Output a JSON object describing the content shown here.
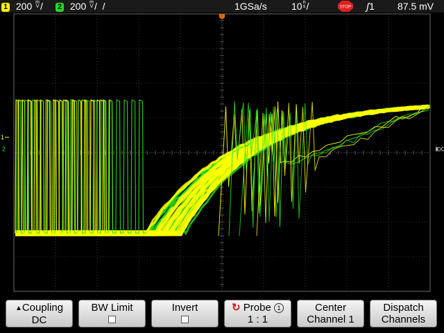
{
  "status": {
    "ch1": {
      "number": "1",
      "scale": "200",
      "unit_top": "m",
      "unit_bottom": "V",
      "color": "#ffff00"
    },
    "ch2": {
      "number": "2",
      "scale": "200",
      "unit_top": "m",
      "unit_bottom": "V",
      "color": "#22dd22"
    },
    "sample_rate": "1GSa/s",
    "timebase": {
      "value": "10",
      "unit_top": "n",
      "unit_bottom": "s"
    },
    "run_state": "STOP",
    "trigger_source": "1",
    "trigger_level": "87.5 mV"
  },
  "markers": {
    "ch1": "1",
    "ch2": "2",
    "dc": "DC"
  },
  "softkeys": [
    {
      "line1": "Coupling",
      "line2": "DC"
    },
    {
      "line1": "BW Limit",
      "line2": ""
    },
    {
      "line1": "Invert",
      "line2": ""
    },
    {
      "line1": "Probe",
      "line2": "1 : 1",
      "badge": "1"
    },
    {
      "line1": "Center",
      "line2": "Channel 1"
    },
    {
      "line1": "Dispatch",
      "line2": "Channels"
    }
  ],
  "colors": {
    "ch1": "#ffff00",
    "ch2": "#22dd22",
    "grid": "#6a6a6a",
    "trigger_marker": "#ff7000"
  }
}
